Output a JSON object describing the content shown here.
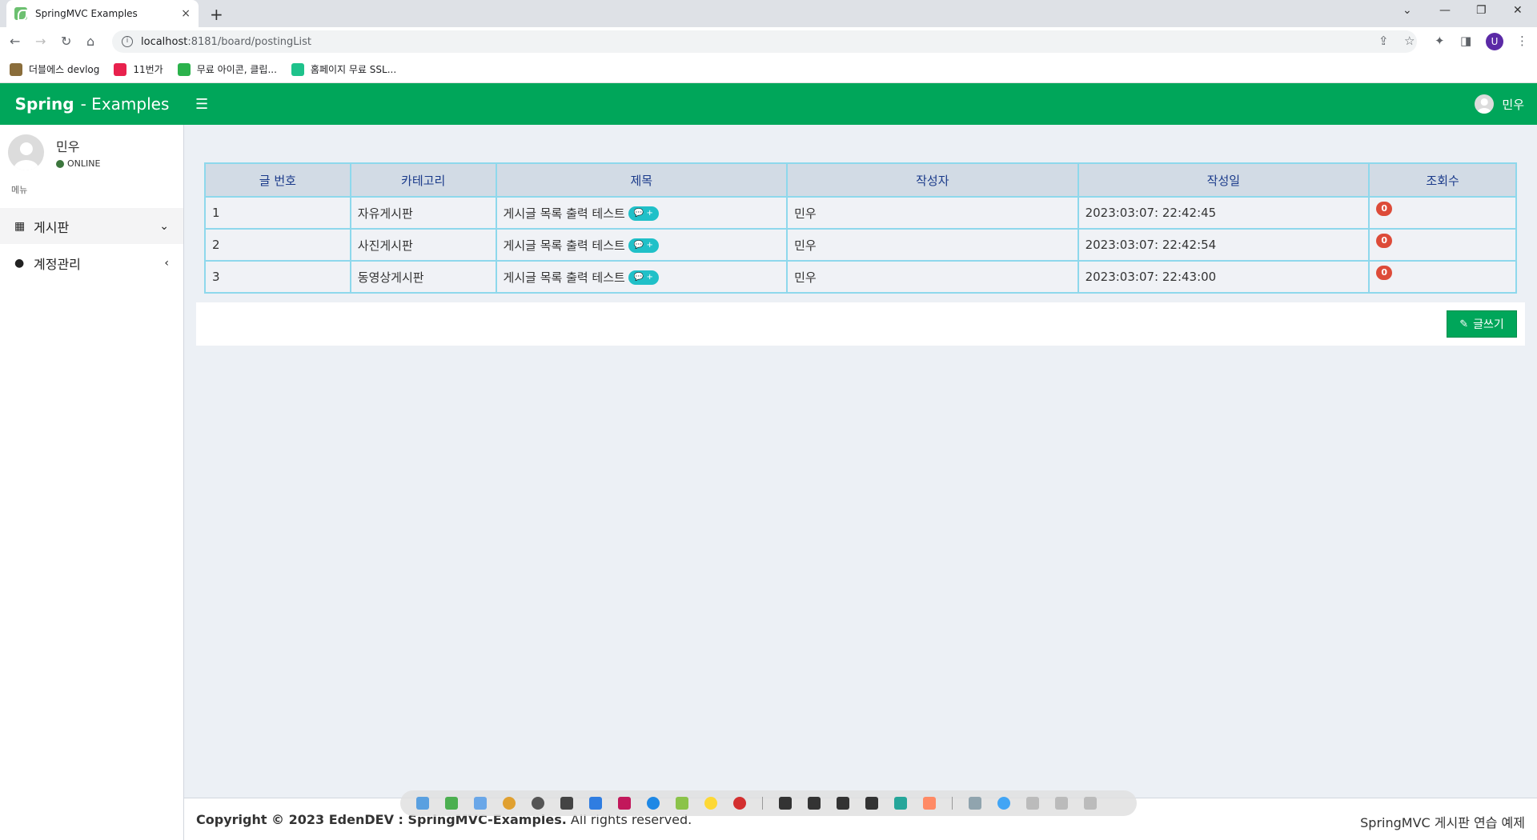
{
  "browser": {
    "tab_title": "SpringMVC Examples",
    "tab_close": "×",
    "new_tab": "+",
    "url_host": "localhost",
    "url_rest": ":8181/board/postingList",
    "profile_initial": "U",
    "bookmarks": [
      {
        "label": "더블에스 devlog",
        "color": "#8a6d3b"
      },
      {
        "label": "11번가",
        "color": "#e8214d"
      },
      {
        "label": "무료 아이콘, 클립...",
        "color": "#2bb24c"
      },
      {
        "label": "홈페이지 무료 SSL...",
        "color": "#1ec28b"
      }
    ]
  },
  "header": {
    "logo_bold": "Spring",
    "logo_light": "- Examples",
    "user_name": "민우",
    "accent": "#00a65a"
  },
  "sidebar": {
    "user_name": "민우",
    "status": "ONLINE",
    "menu_header": "메뉴",
    "items": [
      {
        "label": "게시판",
        "icon": "files-icon"
      },
      {
        "label": "계정관리",
        "icon": "user-icon"
      }
    ]
  },
  "board": {
    "headers": [
      "글 번호",
      "카테고리",
      "제목",
      "작성자",
      "작성일",
      "조회수"
    ],
    "rows": [
      {
        "no": "1",
        "category": "자유게시판",
        "title": "게시글 목록 출력 테스트",
        "comment_badge": "+",
        "author": "민우",
        "date": "2023:03:07: 22:42:45",
        "views": "0"
      },
      {
        "no": "2",
        "category": "사진게시판",
        "title": "게시글 목록 출력 테스트",
        "comment_badge": "+",
        "author": "민우",
        "date": "2023:03:07: 22:42:54",
        "views": "0"
      },
      {
        "no": "3",
        "category": "동영상게시판",
        "title": "게시글 목록 출력 테스트",
        "comment_badge": "+",
        "author": "민우",
        "date": "2023:03:07: 22:43:00",
        "views": "0"
      }
    ],
    "write_button": "글쓰기"
  },
  "footer": {
    "copyright_bold": "Copyright © 2023 EdenDEV : SpringMVC-Examples.",
    "copyright_rest": " All rights reserved.",
    "right_text": "SpringMVC 게시판 연습 예제"
  }
}
